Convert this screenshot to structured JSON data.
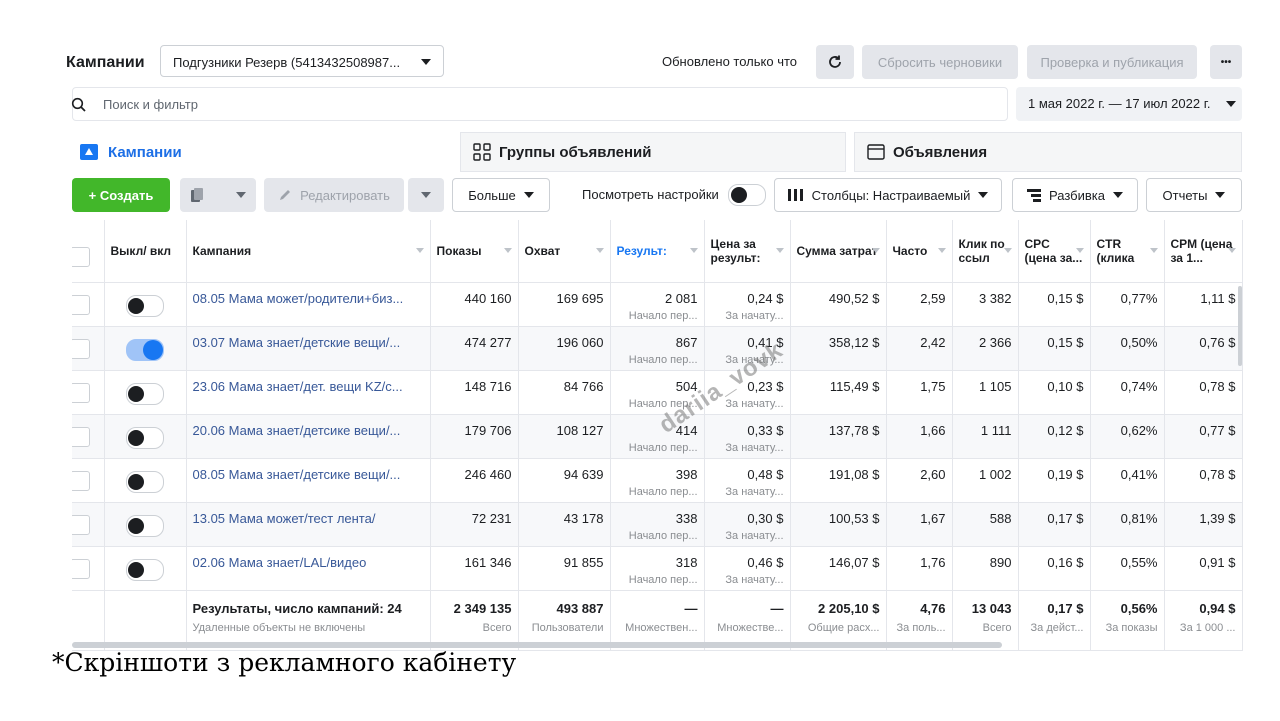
{
  "header": {
    "title": "Кампании",
    "account_selector": "Подгузники Резерв (5413432508987...",
    "updated_status": "Обновлено только что",
    "reset_drafts": "Сбросить черновики",
    "review_publish": "Проверка и публикация",
    "more_glyph": "•••"
  },
  "search": {
    "placeholder": "Поиск и фильтр",
    "date_range": "1 мая 2022 г. — 17 июл 2022 г."
  },
  "tabs": [
    {
      "label": "Кампании"
    },
    {
      "label": "Группы объявлений"
    },
    {
      "label": "Объявления"
    }
  ],
  "toolbar": {
    "create": "+ Создать",
    "edit": "Редактировать",
    "more": "Больше",
    "view_settings": "Посмотреть настройки",
    "columns": "Столбцы: Настраиваемый",
    "breakdown": "Разбивка",
    "reports": "Отчеты"
  },
  "columns": [
    "Выкл/ вкл",
    "Кампания",
    "Показы",
    "Охват",
    "Результ:",
    "Цена за результ:",
    "Сумма затрат",
    "Часто",
    "Клик по ссыл",
    "CPC (цена за...",
    "CTR (клика",
    "CPM (цена за 1..."
  ],
  "rows": [
    {
      "on": false,
      "campaign": "08.05 Мама может/родители+биз...",
      "impressions": "440 160",
      "reach": "169 695",
      "results": "2 081",
      "results_sub": "Начало пер...",
      "cpr": "0,24 $",
      "cpr_sub": "За начату...",
      "spend": "490,52 $",
      "freq": "2,59",
      "clicks": "3 382",
      "cpc": "0,15 $",
      "ctr": "0,77%",
      "cpm": "1,11 $"
    },
    {
      "on": true,
      "campaign": "03.07 Мама знает/детские вещи/...",
      "impressions": "474 277",
      "reach": "196 060",
      "results": "867",
      "results_sub": "Начало пер...",
      "cpr": "0,41 $",
      "cpr_sub": "За начату...",
      "spend": "358,12 $",
      "freq": "2,42",
      "clicks": "2 366",
      "cpc": "0,15 $",
      "ctr": "0,50%",
      "cpm": "0,76 $"
    },
    {
      "on": false,
      "campaign": "23.06 Мама знает/дет. вещи KZ/с...",
      "impressions": "148 716",
      "reach": "84 766",
      "results": "504",
      "results_sub": "Начало пер...",
      "cpr": "0,23 $",
      "cpr_sub": "За начату...",
      "spend": "115,49 $",
      "freq": "1,75",
      "clicks": "1 105",
      "cpc": "0,10 $",
      "ctr": "0,74%",
      "cpm": "0,78 $"
    },
    {
      "on": false,
      "campaign": "20.06 Мама знает/детсике вещи/...",
      "impressions": "179 706",
      "reach": "108 127",
      "results": "414",
      "results_sub": "Начало пер...",
      "cpr": "0,33 $",
      "cpr_sub": "За начату...",
      "spend": "137,78 $",
      "freq": "1,66",
      "clicks": "1 111",
      "cpc": "0,12 $",
      "ctr": "0,62%",
      "cpm": "0,77 $"
    },
    {
      "on": false,
      "campaign": "08.05 Мама знает/детсике вещи/...",
      "impressions": "246 460",
      "reach": "94 639",
      "results": "398",
      "results_sub": "Начало пер...",
      "cpr": "0,48 $",
      "cpr_sub": "За начату...",
      "spend": "191,08 $",
      "freq": "2,60",
      "clicks": "1 002",
      "cpc": "0,19 $",
      "ctr": "0,41%",
      "cpm": "0,78 $"
    },
    {
      "on": false,
      "campaign": "13.05 Мама может/тест лента/",
      "impressions": "72 231",
      "reach": "43 178",
      "results": "338",
      "results_sub": "Начало пер...",
      "cpr": "0,30 $",
      "cpr_sub": "За начату...",
      "spend": "100,53 $",
      "freq": "1,67",
      "clicks": "588",
      "cpc": "0,17 $",
      "ctr": "0,81%",
      "cpm": "1,39 $"
    },
    {
      "on": false,
      "campaign": "02.06 Мама знает/LAL/видео",
      "impressions": "161 346",
      "reach": "91 855",
      "results": "318",
      "results_sub": "Начало пер...",
      "cpr": "0,46 $",
      "cpr_sub": "За начату...",
      "spend": "146,07 $",
      "freq": "1,76",
      "clicks": "890",
      "cpc": "0,16 $",
      "ctr": "0,55%",
      "cpm": "0,91 $"
    }
  ],
  "totals": {
    "label": "Результаты, число кампаний: 24",
    "note": "Удаленные объекты не включены",
    "impressions": "2 349 135",
    "impressions_sub": "Всего",
    "reach": "493 887",
    "reach_sub": "Пользователи",
    "results": "—",
    "results_sub": "Множествен...",
    "cpr": "—",
    "cpr_sub": "Множестве...",
    "spend": "2 205,10 $",
    "spend_sub": "Общие расх...",
    "freq": "4,76",
    "freq_sub": "За поль...",
    "clicks": "13 043",
    "clicks_sub": "Всего",
    "cpc": "0,17 $",
    "cpc_sub": "За дейст...",
    "ctr": "0,56%",
    "ctr_sub": "За показы",
    "cpm": "0,94 $",
    "cpm_sub": "За 1 000 ..."
  },
  "watermark": "dariia_vovk",
  "caption": "*Скріншоти з рекламного кабінету",
  "colors": {
    "accent": "#1877f2",
    "create_green": "#42b72a",
    "link": "#385898"
  }
}
